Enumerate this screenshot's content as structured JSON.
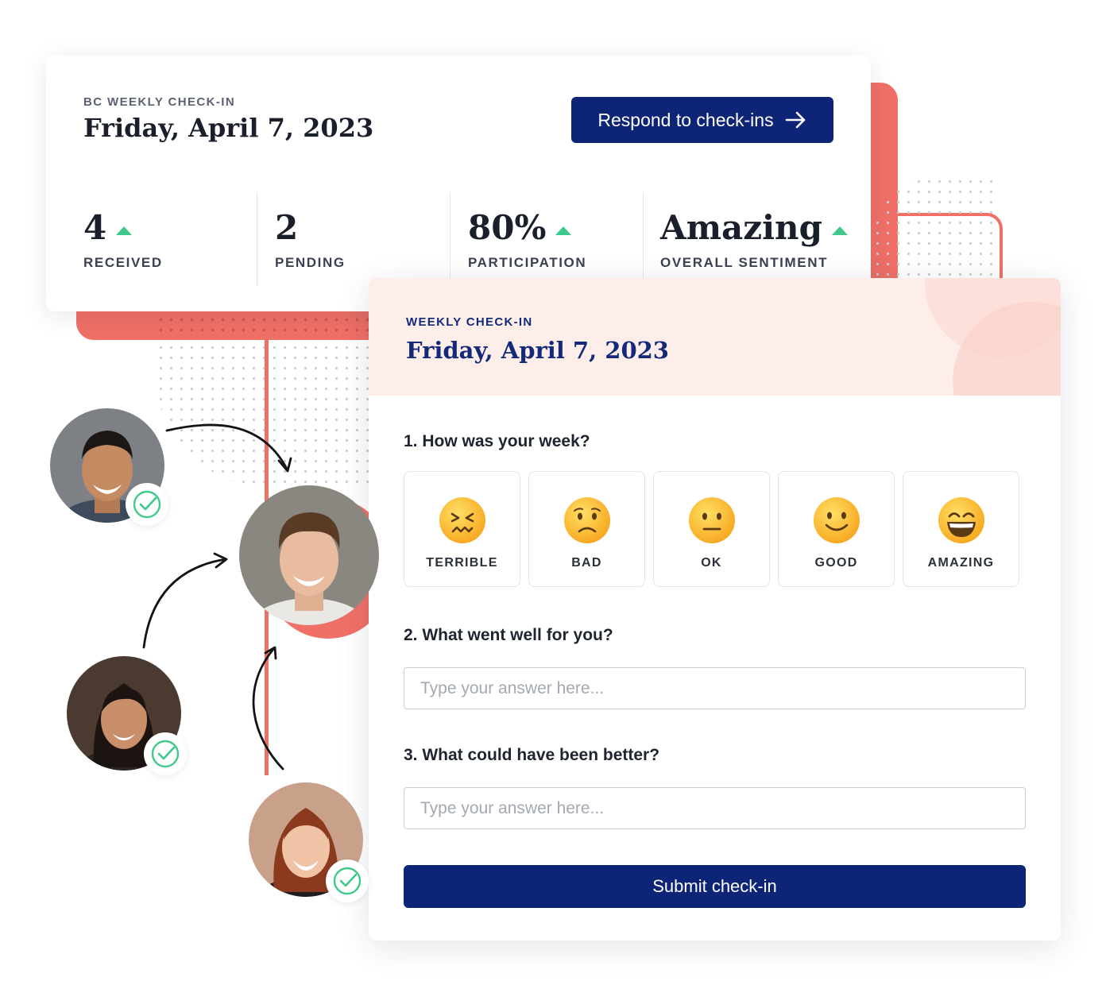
{
  "summary_card": {
    "eyebrow": "BC WEEKLY CHECK-IN",
    "date": "Friday, April 7, 2023",
    "respond_button": "Respond to check-ins",
    "stats": [
      {
        "value": "4",
        "label": "RECEIVED",
        "trend": "up"
      },
      {
        "value": "2",
        "label": "PENDING",
        "trend": "none"
      },
      {
        "value": "80%",
        "label": "PARTICIPATION",
        "trend": "up"
      },
      {
        "value": "Amazing",
        "label": "OVERALL SENTIMENT",
        "trend": "up"
      }
    ]
  },
  "checkin_form": {
    "eyebrow": "WEEKLY CHECK-IN",
    "date": "Friday, April 7, 2023",
    "q1": "1. How was your week?",
    "moods": [
      {
        "label": "TERRIBLE",
        "icon": "confounded-face-icon"
      },
      {
        "label": "BAD",
        "icon": "frowning-face-icon"
      },
      {
        "label": "OK",
        "icon": "neutral-face-icon"
      },
      {
        "label": "GOOD",
        "icon": "smiling-face-icon"
      },
      {
        "label": "AMAZING",
        "icon": "grinning-face-icon"
      }
    ],
    "q2": "2. What went well for you?",
    "q2_placeholder": "Type your answer here...",
    "q3": "3. What could have been better?",
    "q3_placeholder": "Type your answer here...",
    "submit_button": "Submit check-in"
  },
  "colors": {
    "navy": "#0e2577",
    "coral": "#f07068",
    "trend_up": "#3fc98a",
    "header_tint": "#fdeee9",
    "check_green": "#3fc98a"
  }
}
